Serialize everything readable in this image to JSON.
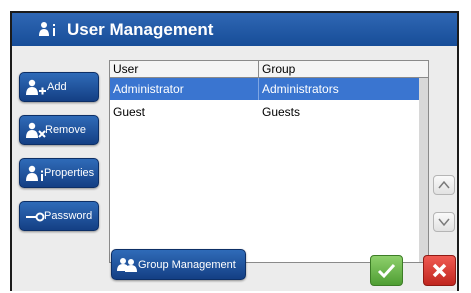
{
  "window": {
    "title": "User Management"
  },
  "sidebar": {
    "add_label": "Add",
    "remove_label": "Remove",
    "properties_label": "Properties",
    "password_label": "Password"
  },
  "table": {
    "headers": [
      "User",
      "Group"
    ],
    "rows": [
      {
        "user": "Administrator",
        "group": "Administrators",
        "selected": true
      },
      {
        "user": "Guest",
        "group": "Guests",
        "selected": false
      }
    ]
  },
  "footer": {
    "group_management_label": "Group Management"
  },
  "icons": {
    "title": "user-info-icon",
    "add": "user-add-icon",
    "remove": "user-remove-icon",
    "properties": "user-info-icon",
    "password": "key-icon",
    "group_management": "group-icon",
    "scroll_up": "chevron-up-icon",
    "scroll_down": "chevron-down-icon",
    "ok": "checkmark-icon",
    "cancel": "close-icon"
  },
  "colors": {
    "accent": "#1f5aa6",
    "selection": "#3a75d0",
    "ok": "#5fae3f",
    "cancel": "#d6342c"
  }
}
